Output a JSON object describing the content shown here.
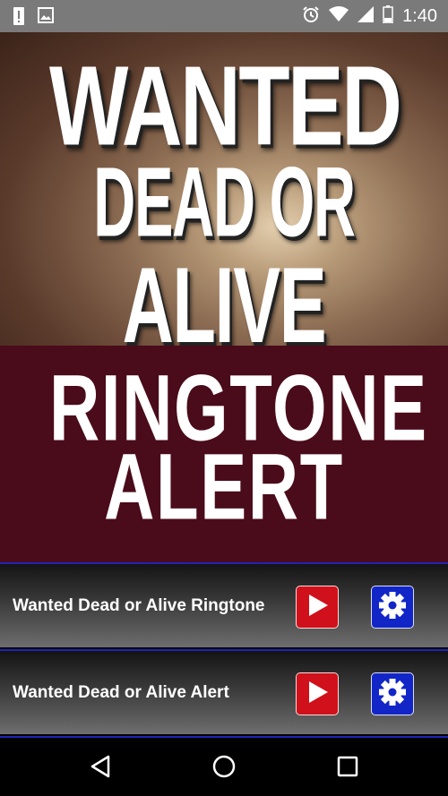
{
  "status_bar": {
    "time": "1:40",
    "icons": [
      "alert-icon",
      "image-icon",
      "alarm-icon",
      "wifi-icon",
      "signal-icon",
      "battery-icon"
    ]
  },
  "banner": {
    "title_line_1": "WANTED",
    "title_line_2": "DEAD OR",
    "title_line_3": "ALIVE",
    "subtitle_line_1": "RINGTONE &",
    "subtitle_line_2": "ALERT"
  },
  "items": [
    {
      "label": "Wanted Dead or Alive Ringtone",
      "play_icon": "play-icon",
      "settings_icon": "gear-icon"
    },
    {
      "label": "Wanted Dead or Alive Alert",
      "play_icon": "play-icon",
      "settings_icon": "gear-icon"
    }
  ],
  "nav_bar": {
    "icons": [
      "back-icon",
      "home-icon",
      "recents-icon"
    ]
  },
  "colors": {
    "status_bar": "#7a7a7a",
    "banner_bottom": "#4a0b1a",
    "play_button": "#d0101a",
    "settings_button": "#1226c8",
    "divider": "#1d24b5"
  }
}
